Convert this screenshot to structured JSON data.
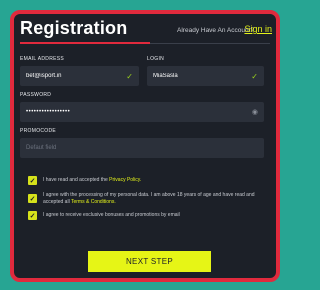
{
  "header": {
    "title": "Registration",
    "already_text": "Already Have An Account?",
    "signin_link": "Sign in"
  },
  "fields": {
    "email": {
      "label": "EMAIL ADDRESS",
      "value": "bet@isport.in"
    },
    "login": {
      "label": "LOGIN",
      "value": "MiaSasla"
    },
    "password": {
      "label": "PASSWORD",
      "value": "•••••••••••••••••"
    },
    "promocode": {
      "label": "PROMOCODE",
      "placeholder": "Defaut field"
    }
  },
  "consents": [
    {
      "text": "I have read and accepted the ",
      "link": "Privacy Policy."
    },
    {
      "text": "I agree with the processing of my personal data. I am above 18 years of age and have read and accepted all ",
      "link": "Terms & Conditions."
    },
    {
      "text": "I agree to receive exclusive bonuses and promotions by email",
      "link": ""
    }
  ],
  "next_button": "NEXT STEP",
  "colors": {
    "background": "#27a593",
    "panel": "#1c2028",
    "border": "#e02a3d",
    "accent": "#e3f21a",
    "valid": "#9ad21c"
  },
  "icons": {
    "valid": "checkmark-icon",
    "password_toggle": "eye-icon",
    "consent_checked": "checkbox-checked-icon"
  }
}
